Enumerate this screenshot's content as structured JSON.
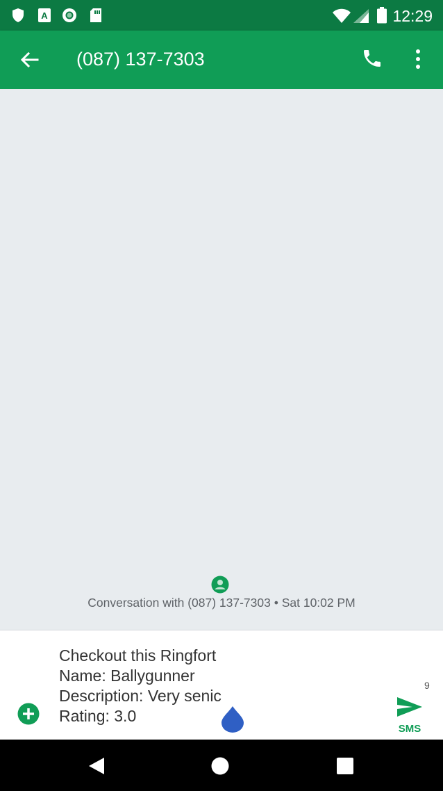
{
  "status_bar": {
    "time": "12:29",
    "icons": [
      "shield-icon",
      "a-badge-icon",
      "circle-record-icon",
      "sd-card-icon",
      "wifi-icon",
      "signal-icon",
      "battery-icon"
    ]
  },
  "app_bar": {
    "title": "(087) 137-7303",
    "icons": [
      "back-arrow-icon",
      "phone-icon",
      "more-vert-icon"
    ],
    "color": "#109d56"
  },
  "conversation": {
    "info": "Conversation with (087) 137-7303 • Sat 10:02 PM"
  },
  "compose": {
    "message": "Checkout this Ringfort\nName: Ballygunner\nDescription: Very senic\nRating: 3.0",
    "char_count": "9",
    "send_label": "SMS"
  },
  "colors": {
    "status_bar": "#0c7a43",
    "accent": "#109d56",
    "background": "#e8ecef",
    "cursor_handle": "#2f5fc4"
  }
}
